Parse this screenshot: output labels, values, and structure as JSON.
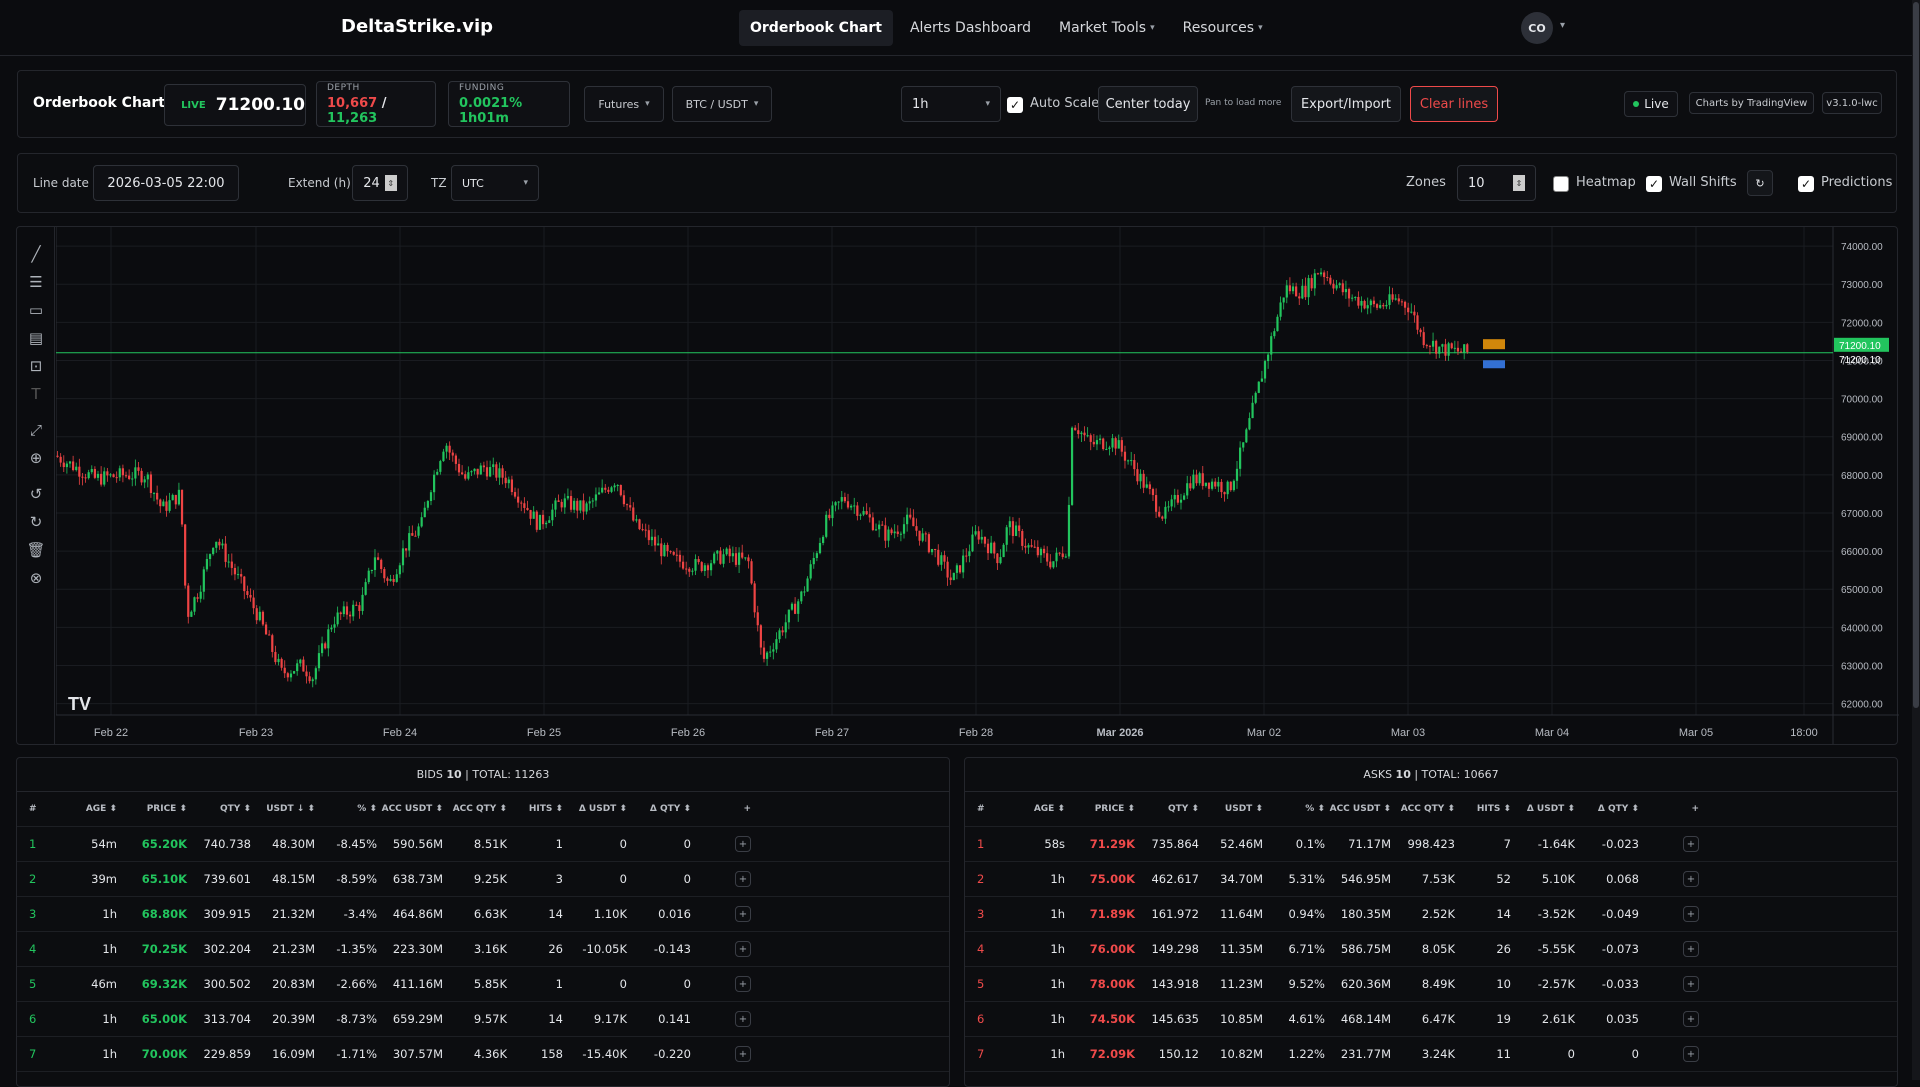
{
  "nav": {
    "brand": "DeltaStrike.vip",
    "links": [
      {
        "label": "Orderbook Chart",
        "active": true,
        "dropdown": false
      },
      {
        "label": "Alerts Dashboard",
        "active": false,
        "dropdown": false
      },
      {
        "label": "Market Tools",
        "active": false,
        "dropdown": true
      },
      {
        "label": "Resources",
        "active": false,
        "dropdown": true
      }
    ],
    "avatar": "CO"
  },
  "header": {
    "title": "Orderbook Chart",
    "live_label": "LIVE",
    "price": "71200.10",
    "depth_label": "DEPTH",
    "depth_bid": "10,667",
    "depth_sep": "/",
    "depth_ask": "11,263",
    "funding_label": "FUNDING",
    "funding_value": "0.0021% 1h01m",
    "market": "Futures",
    "pair": "BTC / USDT",
    "interval": "1h",
    "auto_scale": "Auto Scale",
    "center_today": "Center today",
    "pan_hint": "Pan to load more",
    "export": "Export/Import",
    "clear": "Clear lines",
    "live": "Live",
    "charts_by": "Charts by TradingView",
    "version": "v3.1.0-lwc"
  },
  "controls": {
    "line_date_label": "Line date",
    "line_date": "2026-03-05 22:00",
    "extend_label": "Extend (h)",
    "extend": "24",
    "tz_label": "TZ",
    "tz": "UTC",
    "zones_label": "Zones",
    "zones": "10",
    "heatmap": "Heatmap",
    "wall_shifts": "Wall Shifts",
    "refresh": "↻",
    "predictions": "Predictions",
    "heatmap_on": false,
    "wall_shifts_on": true,
    "predictions_on": true
  },
  "tools": [
    "trend-line-icon",
    "horizontal-lines-icon",
    "rectangle-icon",
    "fib-icon",
    "measure-icon",
    "text-icon",
    "expand-icon",
    "zoom-icon",
    "undo-icon",
    "redo-icon",
    "trash-icon",
    "close-circle-icon"
  ],
  "chart_data": {
    "type": "candlestick",
    "x_labels": [
      "Feb 22",
      "Feb 23",
      "Feb 24",
      "Feb 25",
      "Feb 26",
      "Feb 27",
      "Feb 28",
      "Mar 2026",
      "Mar 02",
      "Mar 03",
      "Mar 04",
      "Mar 05",
      "18:00"
    ],
    "y_ticks": [
      "74000.00",
      "73000.00",
      "72000.00",
      "71000.00",
      "70000.00",
      "69000.00",
      "68000.00",
      "67000.00",
      "66000.00",
      "65000.00",
      "64000.00",
      "63000.00",
      "62000.00"
    ],
    "ylim": [
      61700,
      74500
    ],
    "last_price": "71200.10",
    "line_price": "71200.10",
    "path": [
      [
        0,
        68500
      ],
      [
        25,
        67900
      ],
      [
        45,
        68000
      ],
      [
        58,
        68000
      ],
      [
        68,
        67100
      ],
      [
        80,
        67500
      ],
      [
        84,
        64300
      ],
      [
        92,
        65000
      ],
      [
        102,
        66400
      ],
      [
        118,
        65200
      ],
      [
        130,
        64300
      ],
      [
        145,
        62800
      ],
      [
        158,
        63000
      ],
      [
        165,
        62700
      ],
      [
        178,
        64200
      ],
      [
        196,
        64600
      ],
      [
        205,
        65900
      ],
      [
        214,
        65100
      ],
      [
        224,
        66100
      ],
      [
        235,
        66700
      ],
      [
        240,
        67600
      ],
      [
        250,
        68900
      ],
      [
        254,
        68500
      ],
      [
        263,
        67900
      ],
      [
        275,
        68200
      ],
      [
        290,
        67900
      ],
      [
        310,
        66700
      ],
      [
        325,
        67300
      ],
      [
        340,
        67100
      ],
      [
        360,
        67900
      ],
      [
        372,
        66700
      ],
      [
        395,
        65800
      ],
      [
        413,
        65600
      ],
      [
        430,
        65900
      ],
      [
        445,
        65700
      ],
      [
        454,
        63100
      ],
      [
        464,
        63800
      ],
      [
        480,
        64900
      ],
      [
        494,
        66700
      ],
      [
        506,
        67400
      ],
      [
        516,
        67100
      ],
      [
        534,
        66400
      ],
      [
        548,
        66800
      ],
      [
        566,
        65900
      ],
      [
        576,
        65200
      ],
      [
        592,
        66500
      ],
      [
        606,
        65800
      ],
      [
        612,
        66700
      ],
      [
        625,
        66100
      ],
      [
        640,
        65700
      ],
      [
        650,
        66100
      ],
      [
        653,
        69400
      ],
      [
        665,
        68800
      ],
      [
        680,
        68900
      ],
      [
        694,
        68100
      ],
      [
        712,
        66900
      ],
      [
        730,
        67900
      ],
      [
        745,
        67800
      ],
      [
        754,
        67600
      ],
      [
        764,
        68900
      ],
      [
        776,
        70800
      ],
      [
        790,
        72900
      ],
      [
        802,
        72800
      ],
      [
        812,
        73400
      ],
      [
        830,
        72700
      ],
      [
        848,
        72400
      ],
      [
        862,
        72600
      ],
      [
        870,
        72400
      ],
      [
        878,
        71600
      ],
      [
        890,
        71300
      ],
      [
        908,
        71200
      ]
    ]
  },
  "bids": {
    "title_prefix": "BIDS",
    "count": "10",
    "total": "| TOTAL: 11263",
    "headers": [
      "#",
      "AGE",
      "PRICE",
      "QTY",
      "USDT ↓",
      "%",
      "ACC USDT",
      "ACC QTY",
      "HITS",
      "Δ USDT",
      "Δ QTY",
      "+"
    ],
    "rows": [
      [
        "1",
        "54m",
        "65.20K",
        "740.738",
        "48.30M",
        "-8.45%",
        "590.56M",
        "8.51K",
        "1",
        "0",
        "0"
      ],
      [
        "2",
        "39m",
        "65.10K",
        "739.601",
        "48.15M",
        "-8.59%",
        "638.73M",
        "9.25K",
        "3",
        "0",
        "0"
      ],
      [
        "3",
        "1h",
        "68.80K",
        "309.915",
        "21.32M",
        "-3.4%",
        "464.86M",
        "6.63K",
        "14",
        "1.10K",
        "0.016"
      ],
      [
        "4",
        "1h",
        "70.25K",
        "302.204",
        "21.23M",
        "-1.35%",
        "223.30M",
        "3.16K",
        "26",
        "-10.05K",
        "-0.143"
      ],
      [
        "5",
        "46m",
        "69.32K",
        "300.502",
        "20.83M",
        "-2.66%",
        "411.16M",
        "5.85K",
        "1",
        "0",
        "0"
      ],
      [
        "6",
        "1h",
        "65.00K",
        "313.704",
        "20.39M",
        "-8.73%",
        "659.29M",
        "9.57K",
        "14",
        "9.17K",
        "0.141"
      ],
      [
        "7",
        "1h",
        "70.00K",
        "229.859",
        "16.09M",
        "-1.71%",
        "307.57M",
        "4.36K",
        "158",
        "-15.40K",
        "-0.220"
      ]
    ]
  },
  "asks": {
    "title_prefix": "ASKS",
    "count": "10",
    "total": "| TOTAL: 10667",
    "headers": [
      "#",
      "AGE",
      "PRICE",
      "QTY",
      "USDT",
      "%",
      "ACC USDT",
      "ACC QTY",
      "HITS",
      "Δ USDT",
      "Δ QTY",
      "+"
    ],
    "rows": [
      [
        "1",
        "58s",
        "71.29K",
        "735.864",
        "52.46M",
        "0.1%",
        "71.17M",
        "998.423",
        "7",
        "-1.64K",
        "-0.023"
      ],
      [
        "2",
        "1h",
        "75.00K",
        "462.617",
        "34.70M",
        "5.31%",
        "546.95M",
        "7.53K",
        "52",
        "5.10K",
        "0.068"
      ],
      [
        "3",
        "1h",
        "71.89K",
        "161.972",
        "11.64M",
        "0.94%",
        "180.35M",
        "2.52K",
        "14",
        "-3.52K",
        "-0.049"
      ],
      [
        "4",
        "1h",
        "76.00K",
        "149.298",
        "11.35M",
        "6.71%",
        "586.75M",
        "8.05K",
        "26",
        "-5.55K",
        "-0.073"
      ],
      [
        "5",
        "1h",
        "78.00K",
        "143.918",
        "11.23M",
        "9.52%",
        "620.36M",
        "8.49K",
        "10",
        "-2.57K",
        "-0.033"
      ],
      [
        "6",
        "1h",
        "74.50K",
        "145.635",
        "10.85M",
        "4.61%",
        "468.14M",
        "6.47K",
        "19",
        "2.61K",
        "0.035"
      ],
      [
        "7",
        "1h",
        "72.09K",
        "150.12",
        "10.82M",
        "1.22%",
        "231.77M",
        "3.24K",
        "11",
        "0",
        "0"
      ]
    ]
  },
  "colors": {
    "up": "#22c55e",
    "down": "#ef4444",
    "accent": "#22c55e",
    "danger": "#ef4a4a"
  }
}
